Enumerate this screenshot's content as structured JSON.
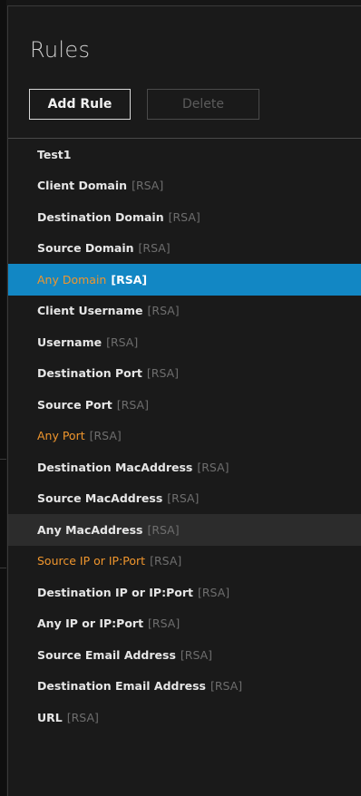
{
  "panel": {
    "title": "Rules"
  },
  "toolbar": {
    "add_label": "Add Rule",
    "delete_label": "Delete"
  },
  "colors": {
    "selected_bg": "#1287c4",
    "highlight_text": "#f0962d",
    "tag_text": "#6e6e6e"
  },
  "rules": [
    {
      "name": "Test1",
      "tag": "",
      "state": "normal"
    },
    {
      "name": "Client Domain",
      "tag": "[RSA]",
      "state": "normal"
    },
    {
      "name": "Destination Domain",
      "tag": "[RSA]",
      "state": "normal"
    },
    {
      "name": "Source Domain",
      "tag": "[RSA]",
      "state": "normal"
    },
    {
      "name": "Any Domain",
      "tag": "[RSA]",
      "state": "selected"
    },
    {
      "name": "Client Username",
      "tag": "[RSA]",
      "state": "normal"
    },
    {
      "name": "Username",
      "tag": "[RSA]",
      "state": "normal"
    },
    {
      "name": "Destination Port",
      "tag": "[RSA]",
      "state": "normal"
    },
    {
      "name": "Source Port",
      "tag": "[RSA]",
      "state": "normal"
    },
    {
      "name": "Any Port",
      "tag": "[RSA]",
      "state": "orange"
    },
    {
      "name": "Destination MacAddress",
      "tag": "[RSA]",
      "state": "normal"
    },
    {
      "name": "Source MacAddress",
      "tag": "[RSA]",
      "state": "normal"
    },
    {
      "name": "Any MacAddress",
      "tag": "[RSA]",
      "state": "hover"
    },
    {
      "name": "Source IP or IP:Port",
      "tag": "[RSA]",
      "state": "orange"
    },
    {
      "name": "Destination IP or IP:Port",
      "tag": "[RSA]",
      "state": "normal"
    },
    {
      "name": "Any IP or IP:Port",
      "tag": "[RSA]",
      "state": "normal"
    },
    {
      "name": "Source Email Address",
      "tag": "[RSA]",
      "state": "normal"
    },
    {
      "name": "Destination Email Address",
      "tag": "[RSA]",
      "state": "normal"
    },
    {
      "name": "URL",
      "tag": "[RSA]",
      "state": "normal"
    }
  ]
}
